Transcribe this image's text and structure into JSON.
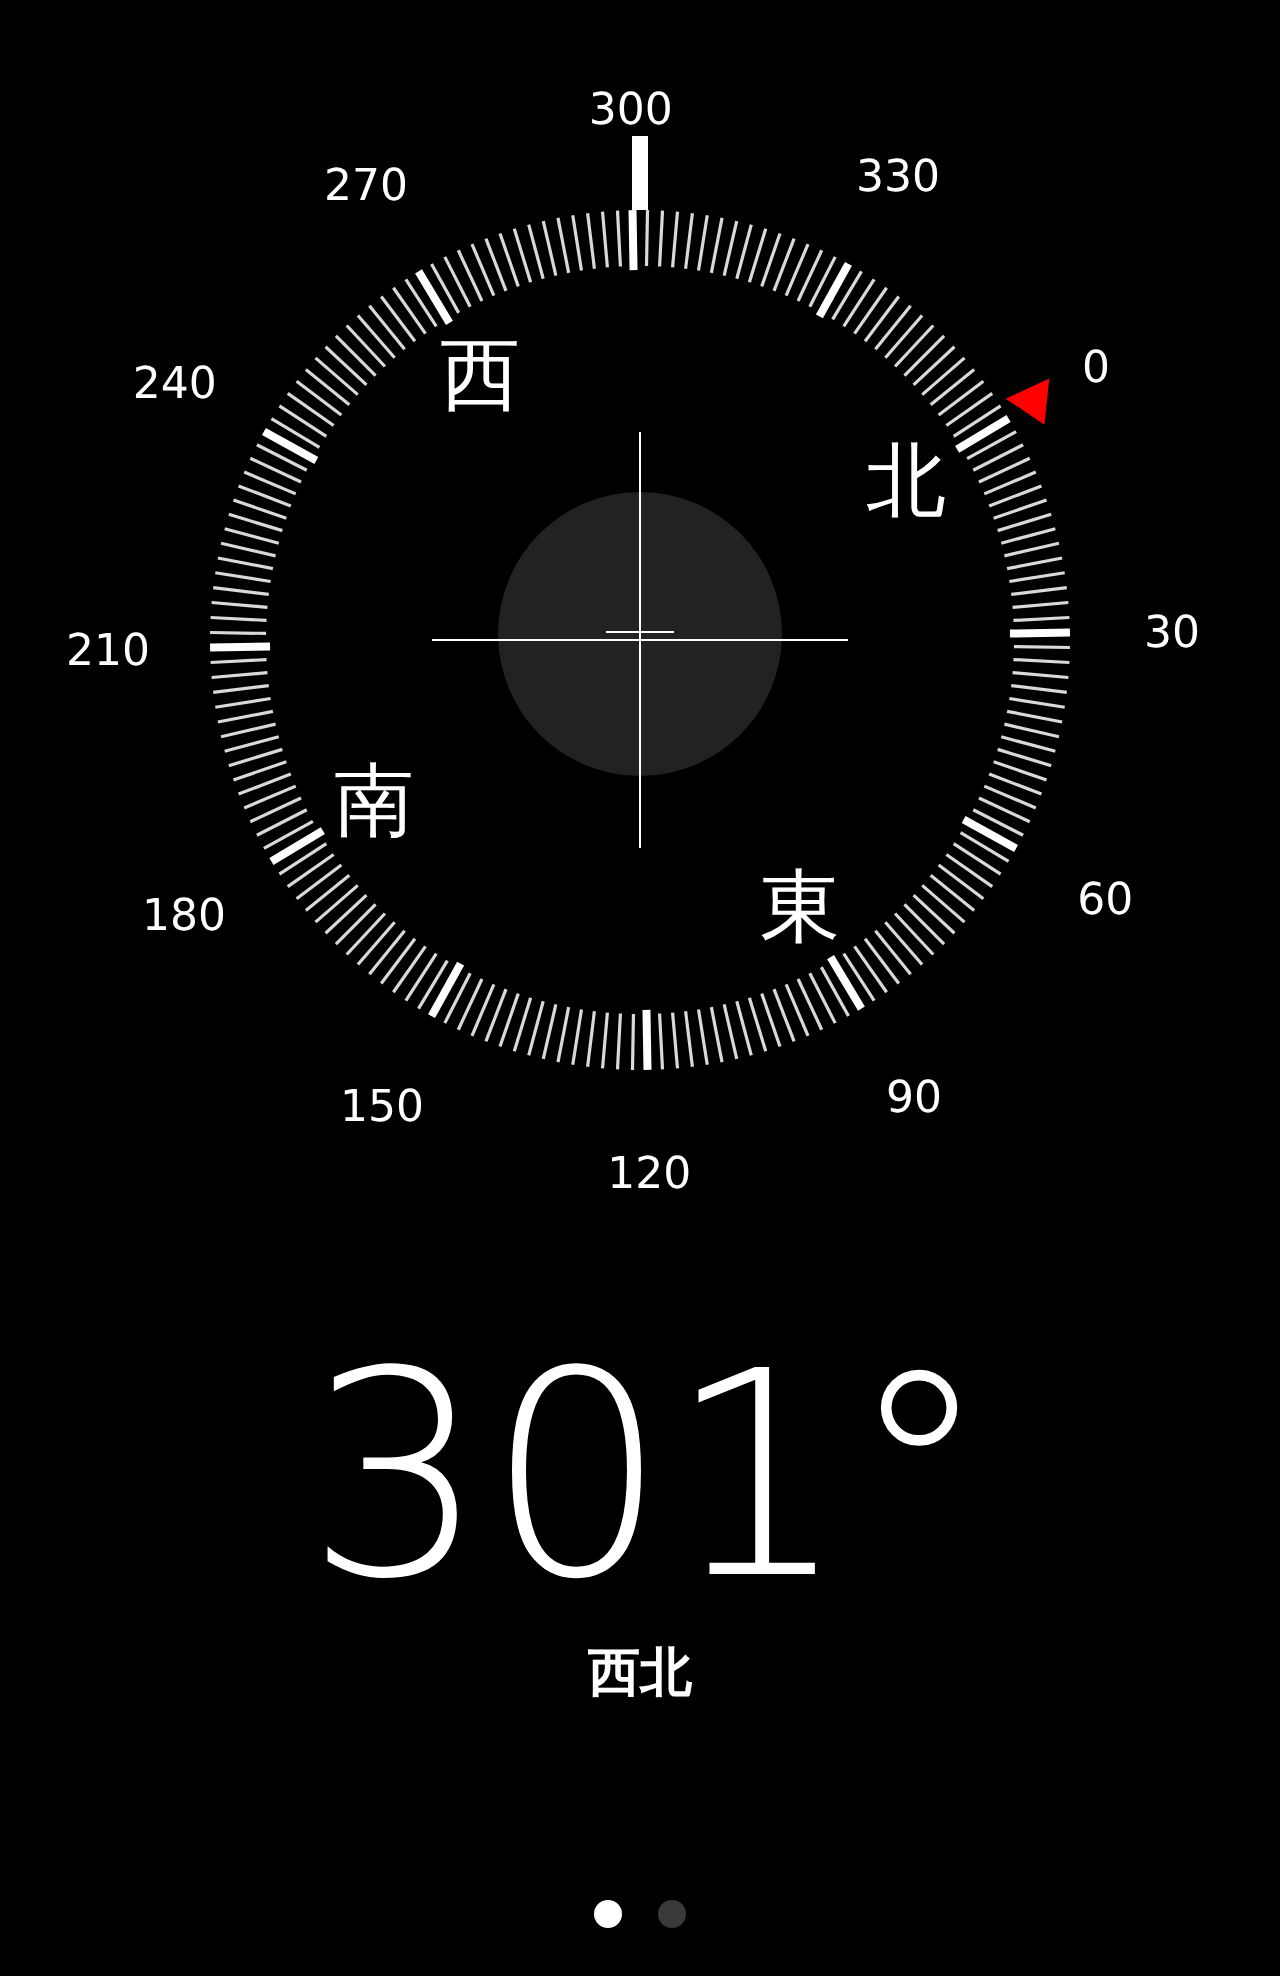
{
  "dial_labels": [
    "0",
    "30",
    "60",
    "90",
    "120",
    "150",
    "180",
    "210",
    "240",
    "270",
    "300",
    "330"
  ],
  "cardinals": [
    "北",
    "東",
    "南",
    "西"
  ],
  "heading": "301°",
  "direction": "西北",
  "page_dots": [
    {
      "selected": true
    },
    {
      "selected": false
    }
  ]
}
